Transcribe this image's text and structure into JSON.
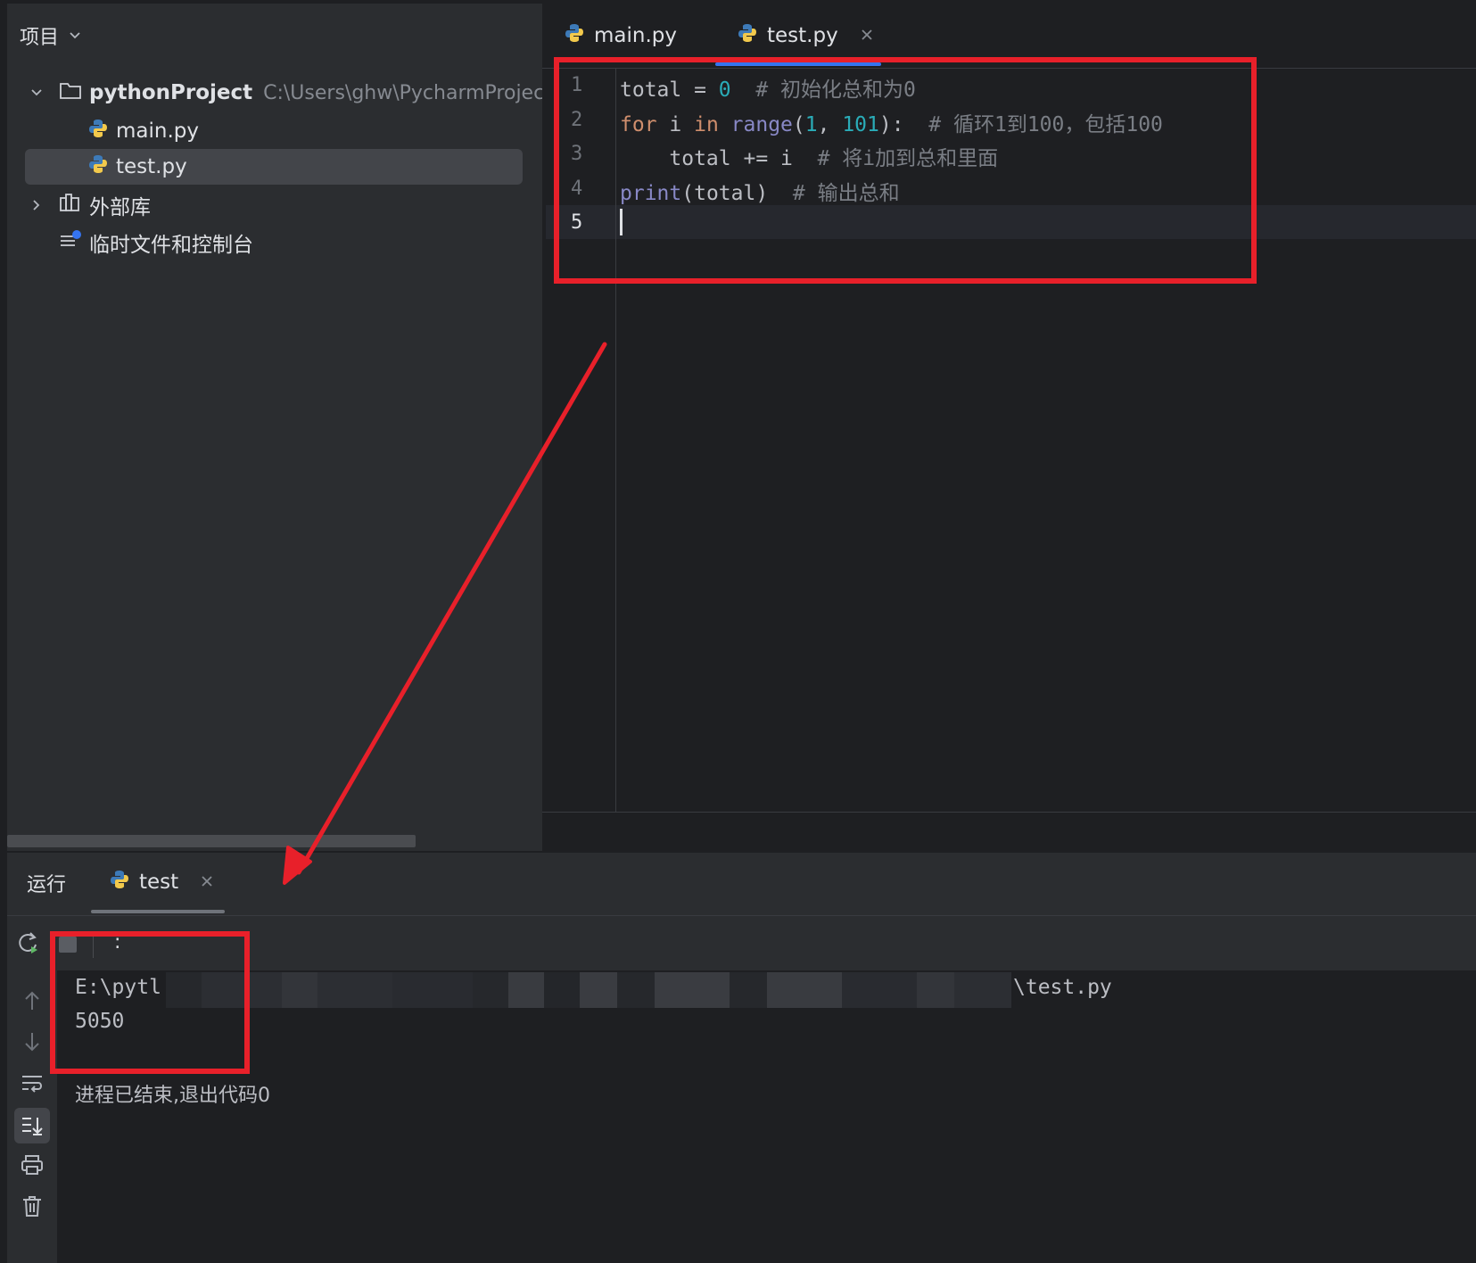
{
  "project_panel": {
    "header_label": "项目",
    "tree": {
      "project_name": "pythonProject",
      "project_path": "C:\\Users\\ghw\\PycharmProjects",
      "files": [
        "main.py",
        "test.py"
      ],
      "external_libs": "外部库",
      "scratches": "临时文件和控制台"
    }
  },
  "editor": {
    "tabs": [
      {
        "label": "main.py",
        "active": false
      },
      {
        "label": "test.py",
        "active": true
      }
    ],
    "line_numbers": [
      "1",
      "2",
      "3",
      "4",
      "5"
    ],
    "code": {
      "l1_ident": "total",
      "l1_op": " = ",
      "l1_num": "0",
      "l1_comment": "  # 初始化总和为0",
      "l2_for": "for",
      "l2_mid": " i ",
      "l2_in": "in",
      "l2_range": "range",
      "l2_paren_open": "(",
      "l2_num1": "1",
      "l2_comma": ", ",
      "l2_num2": "101",
      "l2_paren_close": "):",
      "l2_comment": "  # 循环1到100，包括100",
      "l3_text": "    total += i",
      "l3_comment": "  # 将i加到总和里面",
      "l4_print": "print",
      "l4_args": "(total)",
      "l4_comment": "  # 输出总和"
    }
  },
  "run_panel": {
    "label": "运行",
    "tab": "test",
    "toolbar_sep": ":",
    "console": {
      "cmd_prefix": "E:\\pytl",
      "cmd_suffix": "\\test.py",
      "output": "5050",
      "exit_message": "进程已结束,退出代码0"
    }
  },
  "colors": {
    "annotation_red": "#e8202a",
    "accent_blue": "#3574f0",
    "keyword": "#cf8e6d",
    "number": "#2aacb8",
    "builtin": "#8888c6",
    "comment": "#7a7e85"
  },
  "icons": [
    "chevron-down-icon",
    "folder-icon",
    "python-file-icon",
    "library-icon",
    "scratches-icon",
    "close-icon",
    "rerun-icon",
    "stop-icon",
    "arrow-up-icon",
    "arrow-down-icon",
    "soft-wrap-icon",
    "scroll-to-end-icon",
    "print-icon",
    "trash-icon"
  ]
}
